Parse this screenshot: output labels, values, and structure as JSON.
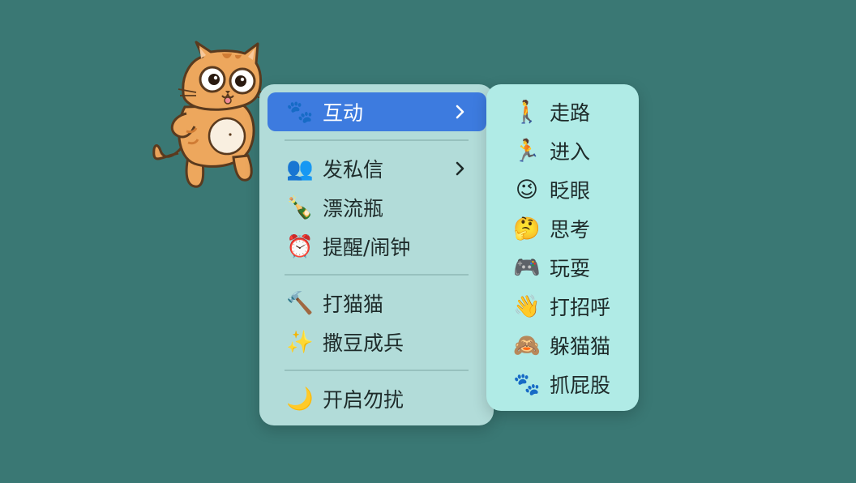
{
  "main_menu": {
    "items": [
      {
        "icon": "🐾",
        "icon_name": "paw-icon",
        "label": "互动",
        "has_submenu": true,
        "active": true
      },
      {
        "icon": "👥",
        "icon_name": "people-icon",
        "label": "发私信",
        "has_submenu": true
      },
      {
        "icon": "🍾",
        "icon_name": "bottle-icon",
        "label": "漂流瓶"
      },
      {
        "icon": "⏰",
        "icon_name": "alarm-clock-icon",
        "label": "提醒/闹钟"
      },
      {
        "icon": "🔨",
        "icon_name": "hammer-icon",
        "label": "打猫猫"
      },
      {
        "icon": "✨",
        "icon_name": "sparkles-icon",
        "label": "撒豆成兵"
      },
      {
        "icon": "🌙",
        "icon_name": "moon-icon",
        "label": "开启勿扰"
      }
    ]
  },
  "submenu": {
    "items": [
      {
        "icon": "🚶",
        "icon_name": "walking-icon",
        "label": "走路"
      },
      {
        "icon": "🏃",
        "icon_name": "running-icon",
        "label": "进入"
      },
      {
        "icon": "😉",
        "icon_name": "wink-icon",
        "label": "眨眼"
      },
      {
        "icon": "🤔",
        "icon_name": "thinking-icon",
        "label": "思考"
      },
      {
        "icon": "🎮",
        "icon_name": "gamepad-icon",
        "label": "玩耍"
      },
      {
        "icon": "👋",
        "icon_name": "wave-icon",
        "label": "打招呼"
      },
      {
        "icon": "🙈",
        "icon_name": "see-no-evil-monkey-icon",
        "label": "躲猫猫"
      },
      {
        "icon": "🐾",
        "icon_name": "paw-icon",
        "label": "抓屁股"
      }
    ]
  },
  "colors": {
    "background": "#3a7874",
    "menu_bg": "#b2dcd9",
    "submenu_bg": "#b0ebe6",
    "active": "#3d7bdf"
  }
}
